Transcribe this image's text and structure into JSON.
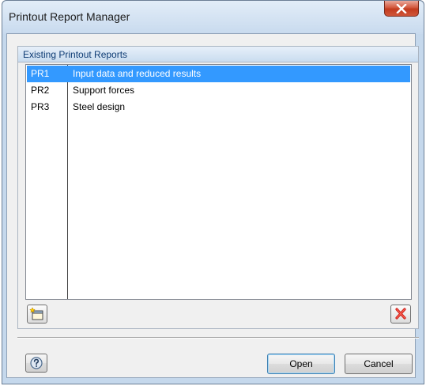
{
  "window": {
    "title": "Printout Report Manager",
    "close_label": "x"
  },
  "group": {
    "label": "Existing Printout Reports"
  },
  "reports": [
    {
      "id": "PR1",
      "description": "Input data and reduced results",
      "selected": true
    },
    {
      "id": "PR2",
      "description": "Support forces",
      "selected": false
    },
    {
      "id": "PR3",
      "description": "Steel design",
      "selected": false
    }
  ],
  "toolbar": {
    "new_icon": "new-report-icon",
    "delete_icon": "delete-icon"
  },
  "footer": {
    "help_icon": "help-icon",
    "open_label": "Open",
    "cancel_label": "Cancel"
  },
  "colors": {
    "selection": "#3399ff",
    "window_frame": "#c5d8ec",
    "close_button": "#c94a31",
    "delete_x": "#d0211b"
  }
}
